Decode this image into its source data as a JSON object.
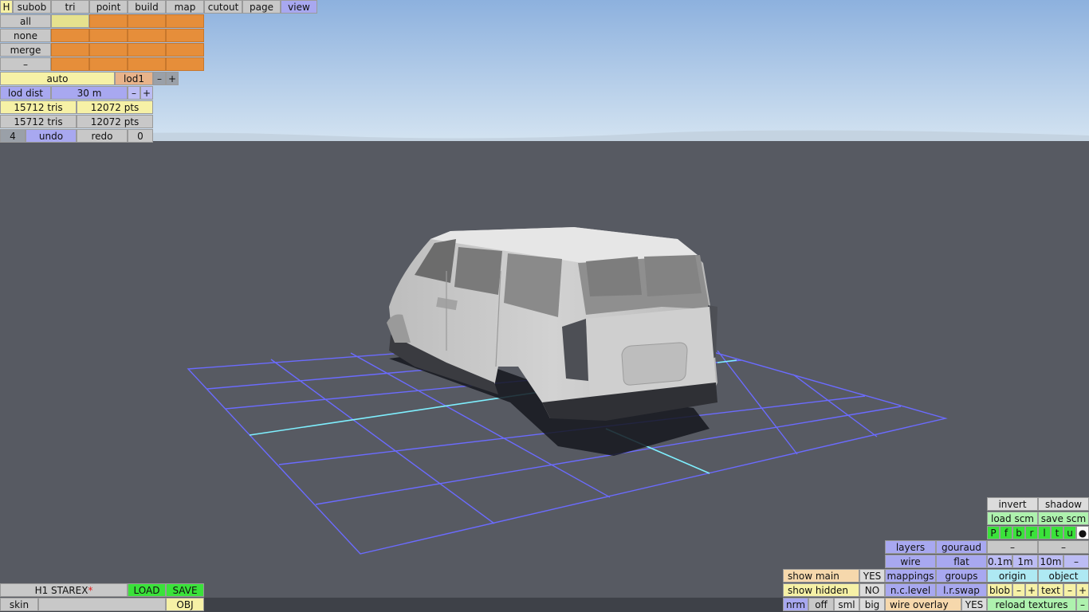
{
  "menu": {
    "h": "H",
    "tabs": [
      "subob",
      "tri",
      "point",
      "build",
      "map",
      "cutout",
      "page",
      "view"
    ]
  },
  "select": {
    "all": "all",
    "none": "none",
    "merge": "merge",
    "minus": "–"
  },
  "lod": {
    "auto": "auto",
    "level": "lod1",
    "minus": "–",
    "plus": "+"
  },
  "lod_dist": {
    "label": "lod dist",
    "value": "30 m",
    "minus": "–",
    "plus": "+"
  },
  "stats": {
    "row1": {
      "tris": "15712 tris",
      "pts": "12072 pts"
    },
    "row2": {
      "tris": "15712 tris",
      "pts": "12072 pts"
    }
  },
  "history": {
    "count": "4",
    "undo": "undo",
    "redo": "redo",
    "redo_count": "0"
  },
  "file": {
    "name": "H1 STAREX",
    "modified": "*",
    "load": "LOAD",
    "save": "SAVE",
    "skin": "skin",
    "obj": "OBJ"
  },
  "right_panel": {
    "invert": "invert",
    "shadow": "shadow",
    "load_scm": "load scm",
    "save_scm": "save scm",
    "views": [
      "P",
      "f",
      "b",
      "r",
      "l",
      "t",
      "u",
      "●"
    ],
    "layers": "layers",
    "gouraud": "gouraud",
    "dash1": "–",
    "dash2": "–",
    "wire": "wire",
    "flat": "flat",
    "grid": [
      "0.1m",
      "1m",
      "10m"
    ],
    "grid_minus": "–",
    "show_main": "show main",
    "show_main_val": "YES",
    "mappings": "mappings",
    "groups": "groups",
    "origin": "origin",
    "object": "object",
    "show_hidden": "show hidden",
    "show_hidden_val": "NO",
    "nc_level": "n.c.level",
    "lr_swap": "l.r.swap",
    "blob": "blob",
    "blob_minus": "–",
    "blob_plus": "+",
    "text": "text",
    "text_minus": "–",
    "text_plus": "+",
    "nrm": "nrm",
    "off": "off",
    "sml": "sml",
    "big": "big",
    "wire_overlay": "wire overlay",
    "wire_overlay_val": "YES",
    "reload_textures": "reload textures",
    "reload_minus": "–"
  },
  "colors": {
    "sky_top": "#8eb2df",
    "sky_bottom": "#cfe0f0",
    "floor": "#575a62",
    "grid": "#6b6bff",
    "axis": "#7ff0ff",
    "car": "#c9c9c9"
  }
}
